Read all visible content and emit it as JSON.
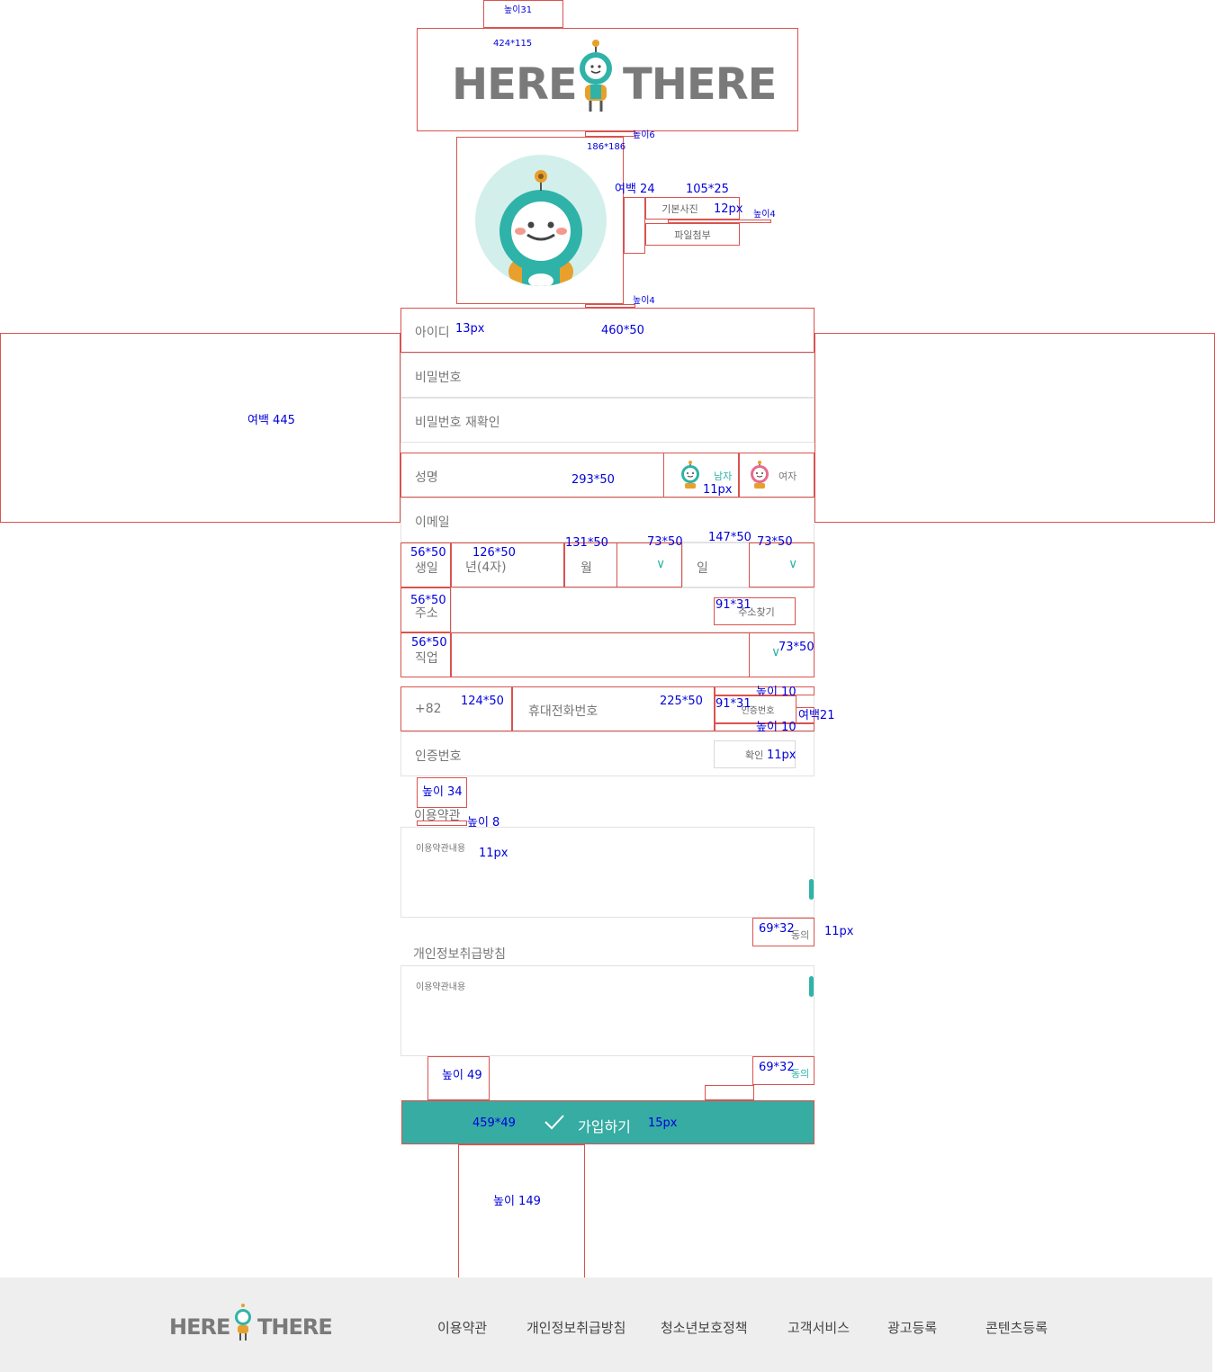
{
  "brand": {
    "left": "HERE",
    "right": "THERE"
  },
  "annotations": {
    "top_height": "높이31",
    "logo_size": "424*115",
    "gap6": "높이6",
    "photo_size": "186*186",
    "margin24": "여백 24",
    "btn_size": "105*25",
    "font12": "12px",
    "gap4_btn": "높이4",
    "gap4_photo": "높이4",
    "id_font": "13px",
    "id_size": "460*50",
    "side_margin": "여백 445",
    "name_size": "293*50",
    "gender_font": "11px",
    "birth_label_size": "56*50",
    "year_size": "126*50",
    "month_size": "131*50",
    "month_sel_size": "73*50",
    "day_size": "147*50",
    "day_sel_size": "73*50",
    "addr_label_size": "56*50",
    "addr_btn_size": "91*31",
    "job_label_size": "56*50",
    "job_sel_size": "73*50",
    "phone_code_size": "124*50",
    "phone_num_size": "225*50",
    "verify_btn_size": "91*31",
    "gap10_top": "높이 10",
    "gap10_bottom": "높이 10",
    "margin21": "여백21",
    "confirm_font": "11px",
    "terms_gap34": "높이 34",
    "terms_gap8": "높이 8",
    "terms_font": "11px",
    "agree_size1": "69*32",
    "agree_font": "11px",
    "gap49": "높이 49",
    "agree_size2": "69*32",
    "submit_size": "459*49",
    "submit_font": "15px",
    "gap149": "높이 149"
  },
  "profile": {
    "default_photo": "기본사진",
    "attach_file": "파일첨부"
  },
  "form": {
    "id_ph": "아이디",
    "pw_ph": "비밀번호",
    "pw2_ph": "비밀번호 재확인",
    "name_ph": "성명",
    "male": "남자",
    "female": "여자",
    "email_ph": "이메일",
    "birth_label": "생일",
    "year_ph": "년(4자)",
    "month_ph": "월",
    "day_ph": "일",
    "addr_label": "주소",
    "addr_btn": "주소찾기",
    "job_label": "직업",
    "phone_code": "+82",
    "phone_ph": "휴대전화번호",
    "verify_btn": "인증번호",
    "code_ph": "인증번호",
    "confirm_btn": "확인"
  },
  "terms": {
    "title": "이용약관",
    "content": "이용약관내용",
    "agree": "동의"
  },
  "privacy": {
    "title": "개인정보취급방침",
    "content": "이용약관내용",
    "agree": "동의"
  },
  "submit": {
    "label": "가입하기"
  },
  "colors": {
    "accent": "#2fb3a8",
    "submit_bg": "#36aca3",
    "annotation": "#0000dd",
    "guide": "#d9534f"
  },
  "footer": {
    "nav": [
      "이용약관",
      "개인정보취급방침",
      "청소년보호정책",
      "고객서비스",
      "광고등록",
      "콘텐츠등록"
    ]
  }
}
